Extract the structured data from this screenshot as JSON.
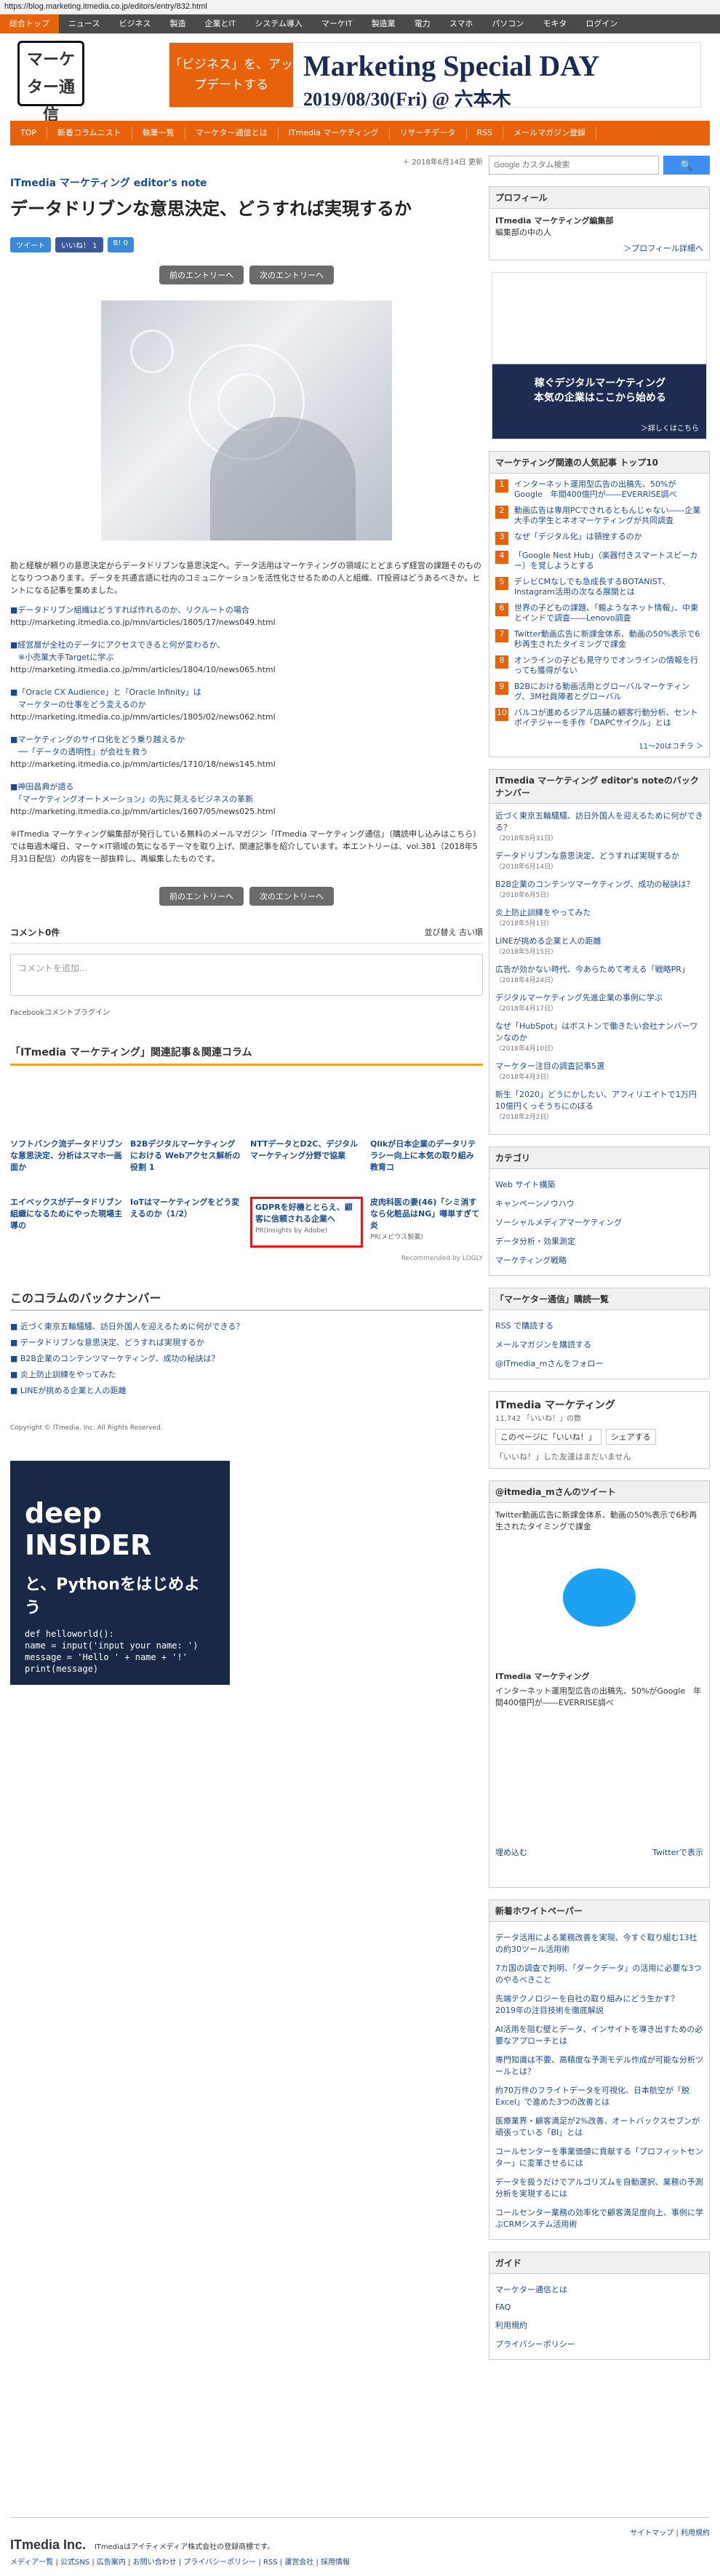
{
  "url": "https://blog.marketing.itmedia.co.jp/editors/entry/832.html",
  "gnav": [
    "総合トップ",
    "ニュース",
    "ビジネス",
    "製造",
    "企業とIT",
    "システム導入",
    "マーケIT",
    "製造業",
    "電力",
    "スマホ",
    "パソコン",
    "モキタ",
    "ログイン"
  ],
  "logo": "マーケター通信",
  "banner": {
    "left": "「ビジネス」を、アップデートする",
    "title": "Marketing Special DAY",
    "date": "2019/08/30(Fri) @ 六本木"
  },
  "onav": [
    "TOP",
    "新着コラムニスト",
    "執筆一覧",
    "マーケター通信とは",
    "ITmedia マーケティング",
    "リサーチデータ",
    "RSS",
    "メールマガジン登録"
  ],
  "date": "＋ 2018年6月14日 更新",
  "blogname": "ITmedia マーケティング editor's note",
  "title": "データドリブンな意思決定、どうすれば実現するか",
  "share": {
    "tweet": "ツイート",
    "like": "いいね！ 1",
    "b": "B! 0"
  },
  "pn": {
    "prev": "前のエントリーへ",
    "next": "次のエントリーへ"
  },
  "intro": "勘と経験が頼りの意思決定からデータドリブンな意思決定へ。データ活用はマーケティングの領域にとどまらず経営の課題そのものとなりつつあります。データを共通言語に社内のコミュニケーションを活性化させるための人と組織、IT投資はどうあるべきか。ヒントになる記事を集めました。",
  "links": [
    {
      "t": "■データドリブン組織はどうすれば作れるのか、リクルートの場合",
      "u": "http://marketing.itmedia.co.jp/mm/articles/1805/17/news049.html"
    },
    {
      "t": "■経営層が全社のデータにアクセスできると何が変わるか、\n　※小売業大手Targetに学ぶ",
      "u": "http://marketing.itmedia.co.jp/mm/articles/1804/10/news065.html"
    },
    {
      "t": "■「Oracle CX Audience」と「Oracle Infinity」は\n　マーケターの仕事をどう変えるのか",
      "u": "http://marketing.itmedia.co.jp/mm/articles/1805/02/news062.html"
    },
    {
      "t": "■マーケティングのサイロ化をどう乗り越えるか\n　──「データの透明性」が会社を救う",
      "u": "http://marketing.itmedia.co.jp/mm/articles/1710/18/news145.html"
    },
    {
      "t": "■神田昌典が語る\n　「マーケティングオートメーション」の先に見えるビジネスの革新",
      "u": "http://marketing.itmedia.co.jp/mm/articles/1607/05/news025.html"
    }
  ],
  "note": "※ITmedia マーケティング編集部が発行している無料のメールマガジン「ITmedia マーケティング通信」（購読申し込みはこちら）では毎週木曜日、マーケ×IT領域の気になるテーマを取り上げ、関連記事を紹介しています。本エントリーは、vol.381（2018年5月31日配信）の内容を一部抜粋し、再編集したものです。",
  "comments": {
    "count": "コメント0件",
    "sort": "並び替え 古い順",
    "placeholder": "コメントを追加...",
    "plugin": "Facebookコメントプラグイン"
  },
  "related": {
    "head": "「ITmedia マーケティング」関連記事＆関連コラム",
    "cards": [
      "ソフトバンク流データドリブンな意思決定、分析はスマホ一画面か",
      "B2Bデジタルマーケティングにおける Webアクセス解析の役割 1",
      "NTTデータとD2C、デジタルマーケティング分野で協業",
      "Qlikが日本企業のデータリテラシー向上に本気の取り組み　教育コ",
      "エイベックスがデータドリブン組織になるためにやった現場主導の",
      "IoTはマーケティングをどう変えるのか（1/2）",
      "GDPRを好機ととらえ、顧客に信頼される企業へ",
      "皮肉科医の妻(46)「シミ消すなら化粧品はNG」噂単すぎて炎"
    ],
    "ad1": "PR(Insights by Adobe)",
    "ad2": "PR(メビウス製薬)",
    "rec": "Recommended by LOGLY"
  },
  "back": {
    "title": "このコラムのバックナンバー",
    "items": [
      "近づく東京五輪騒騒、訪日外国人を迎えるために何ができる？",
      "データドリブンな意思決定、どうすれば実現するか",
      "B2B企業のコンテンツマーケティング、成功の秘訣は？",
      "炎上防止訓練をやってみた",
      "LINEが挑める企業と人の距離"
    ]
  },
  "copyright": "Copyright © ITmedia, Inc. All Rights Reserved.",
  "deep": {
    "brand": "deep INSIDER",
    "sub": "と、Pythonをはじめよう",
    "code": "def helloworld():\n    name = input('input your name: ')\n    message = 'Hello ' + name + '!'\n    print(message)\n\nhelloworld()"
  },
  "side": {
    "search": "Google カスタム検索",
    "profile": {
      "h": "プロフィール",
      "name": "ITmedia マーケティング編集部",
      "role": "編集部の中の人",
      "more": "＞プロフィール詳細へ"
    },
    "ad": {
      "head": "稼ぐデジタルマーケティング\n本気の企業はここから始める",
      "more": "＞詳しくはこちら"
    },
    "rankh": "マーケティング関連の人気記事 トップ10",
    "rank": [
      "インターネット運用型広告の出稿先、50%がGoogle　年間400億円が――EVERRISE調べ",
      "動画広告は専用PCでされるともんじゃない――企業大手の学生とネオマーケティングが共同調査",
      "なぜ「デジタル化」は頓挫するのか",
      "「Google Nest Hub」（楽器付きスマートスピーカー）を覚しようとする",
      "デレビCMなしでも急成長するBOTANIST、Instagram活用の次なる展開とは",
      "世界の子どもの課題、「親ようなネット情報」、中東とインドで調査――Lenovo調査",
      "Twitter動画広告に新課金体系、動画の50%表示で6秒再生されたタイミングで課金",
      "オンラインの子ども見守りでオンラインの情報を行っても獲得がない",
      "B2Bにおける動画活用とグローバルマーケティング、3M社員陣者とグローバル",
      "バルコが進めるジアル店舗の顧客行動分析、セントポイテジャーを手作「DAPCサイクル」とは"
    ],
    "rankmore": "11～20はコチラ ＞",
    "bnh": "ITmedia マーケティング editor's noteのバックナンバー",
    "bn": [
      [
        "近づく東京五輪騒騒、訪日外国人を迎えるために何ができる？",
        "（2018年8月31日）"
      ],
      [
        "データドリブンな意思決定、どうすれば実現するか",
        "（2018年6月14日）"
      ],
      [
        "B2B企業のコンテンツマーケティング、成功の秘訣は？",
        "（2018年6月5日）"
      ],
      [
        "炎上防止訓練をやってみた",
        "（2018年5月1日）"
      ],
      [
        "LINEが挑める企業と人の距離",
        "（2018年5月15日）"
      ],
      [
        "広告が効かない時代、今あらためて考える「戦略PR」",
        "（2018年4月24日）"
      ],
      [
        "デジタルマーケティング先進企業の事例に学ぶ",
        "（2018年4月17日）"
      ],
      [
        "なぜ「HubSpot」はボストンで働きたい会社ナンバーワンなのか",
        "（2018年4月10日）"
      ],
      [
        "マーケター注目の調査記事5選",
        "（2018年4月3日）"
      ],
      [
        "新生「2020」どうにかしたい、アフィリエイトで1万円10億円くっそうちにのぼる",
        "（2018年2月2日）"
      ]
    ],
    "cath": "カテゴリ",
    "cats": [
      "Web サイト構築",
      "キャンペーンノウハウ",
      "ソーシャルメディアマーケティング",
      "データ分析・効果測定",
      "マーケティング戦略"
    ],
    "subh": "「マーケター通信」購読一覧",
    "subs": [
      "RSS で購読する",
      "メールマガジンを購読する",
      "@ITmedia_mさんをフォロー"
    ],
    "fb": {
      "name": "ITmedia マーケティング",
      "likes": "11,742 「いいね！」の数",
      "like": "このページに「いいね！」",
      "share": "シェアする",
      "empty": "「いいね！」した友達はまだいません"
    },
    "twh": "@itmedia_mさんのツイート",
    "tw1": "Twitter動画広告に新課金体系、動画の50%表示で6秒再生されたタイミングで課金",
    "twaccount": "ITmedia マーケティング",
    "tw2": "インターネット運用型広告の出稿先、50%がGoogle　年間400億円が――EVERRISE調べ",
    "twembed": "埋め込む",
    "twview": "Twitterで表示",
    "newwh": "新着ホワイトペーパー",
    "neww": [
      "データ活用による業務改善を実現、今すぐ取り組む13社の約30ツール活用術",
      "7カ国の調査で判明、「ダークデータ」の活用に必要な3つのやるべきこと",
      "先端テクノロジーを自社の取り組みにどう生かす？　2019年の注目技術を徹底解説",
      "AI活用を阻む壁とデータ、インサイトを導き出すための必要なアプローチとは",
      "専門知識は不要、高精度な予測モデル作成が可能な分析ツールとは？",
      "約70万件のフライトデータを可視化、日本航空が「脱Excel」で進めた3つの改善とは",
      "医療業界・顧客満足が2%改善、オートバックスセブンが頑張っている「BI」とは",
      "コールセンターを事業価値に貢献する「プロフィットセンター」に変革させるには",
      "データを扱うだけでアルゴリズムを自動選択、業務の予測分析を実現するには",
      "コールセンター業務の効率化で顧客満足度向上、事例に学ぶCRMシステム活用術"
    ],
    "guideh": "ガイド",
    "guide": [
      "マーケター通信とは",
      "FAQ",
      "利用規約",
      "プライバシーポリシー"
    ]
  },
  "footer": {
    "right": "サイトマップ | 利用規約",
    "brand": "ITmedia Inc.",
    "desc": "ITmediaはアイティメディア株式会社の登録商標です。",
    "links": "メディア一覧 | 公式SNS | 広告案内 | お問い合わせ | プライバシーポリシー | RSS | 運営会社 | 採用情報"
  }
}
